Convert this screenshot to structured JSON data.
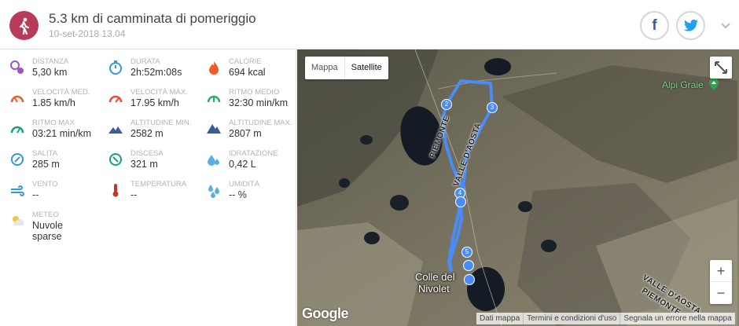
{
  "header": {
    "title": "5.3 km di camminata di pomeriggio",
    "date": "10-set-2018 13.04",
    "activity_icon": "hiker-icon",
    "activity_color": "#b73c5a",
    "share_facebook": "f",
    "share_twitter_icon": "twitter-bird-icon",
    "expand_icon": "chevron-down-icon"
  },
  "stats": [
    {
      "label": "DISTANZA",
      "value": "5,30 km",
      "icon": "distance-pin-icon",
      "color": "#9b59b6"
    },
    {
      "label": "DURATA",
      "value": "2h:52m:08s",
      "icon": "stopwatch-icon",
      "color": "#3498db"
    },
    {
      "label": "CALORIE",
      "value": "694 kcal",
      "icon": "flame-icon",
      "color": "#f15a29"
    },
    {
      "label": "VELOCITÀ MED.",
      "value": "1.85 km/h",
      "icon": "speed-gauge-icon",
      "color": "#f15a29"
    },
    {
      "label": "VELOCITÀ MAX.",
      "value": "17.95 km/h",
      "icon": "speed-gauge-max-icon",
      "color": "#e74c3c"
    },
    {
      "label": "RITMO MEDIO",
      "value": "32:30 min/km",
      "icon": "pace-gauge-icon",
      "color": "#27ae60"
    },
    {
      "label": "RITMO MAX",
      "value": "03:21 min/km",
      "icon": "pace-gauge-max-icon",
      "color": "#16a085"
    },
    {
      "label": "ALTITUDINE MIN.",
      "value": "2582 m",
      "icon": "mountain-min-icon",
      "color": "#3d5a9c"
    },
    {
      "label": "ALTITUDINE MAX.",
      "value": "2807 m",
      "icon": "mountain-max-icon",
      "color": "#3d5a9c"
    },
    {
      "label": "SALITA",
      "value": "285 m",
      "icon": "ascent-compass-icon",
      "color": "#3498db"
    },
    {
      "label": "DISCESA",
      "value": "321 m",
      "icon": "descent-compass-icon",
      "color": "#16a085"
    },
    {
      "label": "IDRATAZIONE",
      "value": "0,42 L",
      "icon": "water-drops-icon",
      "color": "#5dade2"
    },
    {
      "label": "VENTO",
      "value": "--",
      "icon": "wind-icon",
      "color": "#3498db"
    },
    {
      "label": "TEMPERATURA",
      "value": "--",
      "icon": "thermometer-icon",
      "color": "#c0392b"
    },
    {
      "label": "UMIDITÀ",
      "value": "-- %",
      "icon": "humidity-icon",
      "color": "#5dade2"
    },
    {
      "label": "METEO",
      "value": "Nuvole sparse",
      "icon": "partly-cloudy-icon",
      "color": "#f5c542"
    }
  ],
  "map": {
    "toggle_map": "Mappa",
    "toggle_satellite": "Satellite",
    "active_mode": "Satellite",
    "zoom_in": "+",
    "zoom_out": "−",
    "fullscreen_icon": "fullscreen-icon",
    "brand": "Google",
    "footer_links": [
      "Dati mappa",
      "Termini e condizioni d'uso",
      "Segnala un errore nella mappa"
    ],
    "place_label": "Colle del Nivolet",
    "place_line1": "Colle del",
    "place_line2": "Nivolet",
    "poi_label": "Alpi Graie",
    "region_labels": [
      "PIEMONTE",
      "VALLE D'AOSTA"
    ],
    "region_labels_se": [
      "VALLE D'AOSTA",
      "PIEMONTE"
    ],
    "route_color": "#4a8cf7",
    "markers": [
      "2",
      "3",
      "4",
      "5"
    ]
  }
}
